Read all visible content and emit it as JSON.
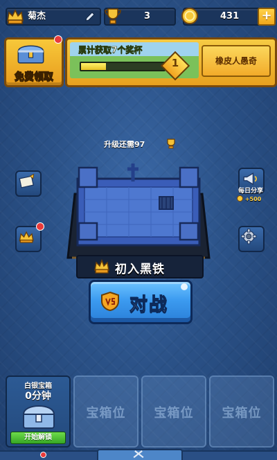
{
  "header": {
    "player_name": "菊杰",
    "trophies": "3",
    "gold": "431",
    "add_gold": "+"
  },
  "free_chest": {
    "label": "免费领取"
  },
  "trophy_road": {
    "title": "累计获取7个奖杯",
    "progress": 0.3,
    "level": "1",
    "button_label": "橡皮人愚奇"
  },
  "arena": {
    "upgrade_label": "升级还需97",
    "name": "初入黑铁"
  },
  "daily_share": {
    "label": "每日分享",
    "reward": "+500"
  },
  "battle": {
    "label": "对战"
  },
  "chest_slots": [
    {
      "name": "白银宝箱",
      "time": "0分钟",
      "button": "开始解锁"
    },
    {
      "label": "宝箱位"
    },
    {
      "label": "宝箱位"
    },
    {
      "label": "宝箱位"
    }
  ],
  "colors": {
    "gold": "#f5b52a",
    "battle_blue": "#3c9bf0",
    "unlock_green": "#36a724",
    "background": "#2b5288"
  }
}
